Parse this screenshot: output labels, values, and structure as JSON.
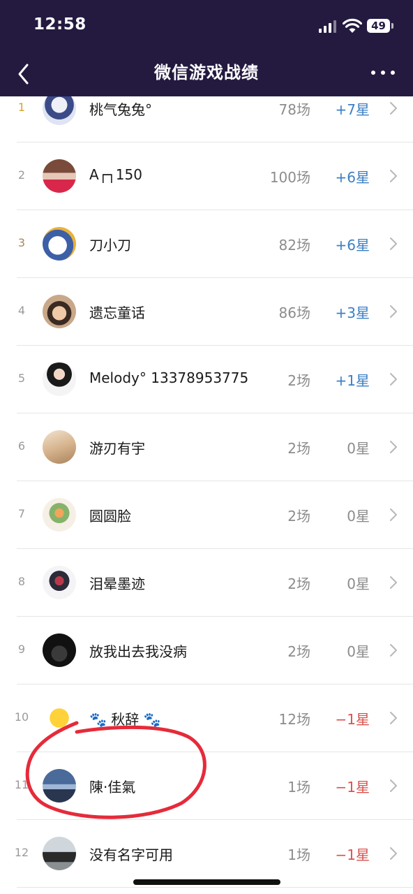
{
  "status_bar": {
    "time": "12:58",
    "battery": "49"
  },
  "nav": {
    "title": "微信游戏战绩",
    "back_icon": "chevron-left-icon",
    "more_icon": "ellipsis-icon"
  },
  "colors": {
    "header_bg": "#241a40",
    "positive": "#3b7fc4",
    "neutral": "#8c8c8c",
    "negative": "#d9534f",
    "rank_gold": "#d2a623",
    "rank_bronze": "#a8865c",
    "annotation": "#e52b3a"
  },
  "rows": [
    {
      "rank": "1",
      "name": "桃气兔兔°",
      "games": "78场",
      "stars": "+7星",
      "trend": "positive",
      "avatar": "anime-girl-avatar"
    },
    {
      "rank": "2",
      "name": "A┌┐150",
      "games": "100场",
      "stars": "+6星",
      "trend": "positive",
      "avatar": "festival-poster-avatar"
    },
    {
      "rank": "3",
      "name": "刀小刀",
      "games": "82场",
      "stars": "+6星",
      "trend": "positive",
      "avatar": "white-bird-avatar"
    },
    {
      "rank": "4",
      "name": "遗忘童话",
      "games": "86场",
      "stars": "+3星",
      "trend": "positive",
      "avatar": "child-portrait-avatar"
    },
    {
      "rank": "5",
      "name": "Melody° 13378953775",
      "games": "2场",
      "stars": "+1星",
      "trend": "positive",
      "avatar": "woman-portrait-avatar"
    },
    {
      "rank": "6",
      "name": "游刃有宇",
      "games": "2场",
      "stars": "0星",
      "trend": "neutral",
      "avatar": "beige-photo-avatar"
    },
    {
      "rank": "7",
      "name": "圆圆脸",
      "games": "2场",
      "stars": "0星",
      "trend": "neutral",
      "avatar": "flower-bouquet-avatar"
    },
    {
      "rank": "8",
      "name": "泪晕墨迹",
      "games": "2场",
      "stars": "0星",
      "trend": "neutral",
      "avatar": "ink-art-avatar"
    },
    {
      "rank": "9",
      "name": "放我出去我没病",
      "games": "2场",
      "stars": "0星",
      "trend": "neutral",
      "avatar": "dark-photo-avatar"
    },
    {
      "rank": "10",
      "name": "🐾 秋辞 🐾",
      "games": "12场",
      "stars": "−1星",
      "trend": "negative",
      "avatar": "sun-emoji-avatar"
    },
    {
      "rank": "11",
      "name": "陳·佳氣",
      "games": "1场",
      "stars": "−1星",
      "trend": "negative",
      "avatar": "city-night-avatar"
    },
    {
      "rank": "12",
      "name": "没有名字可用",
      "games": "1场",
      "stars": "−1星",
      "trend": "negative",
      "avatar": "street-person-avatar"
    }
  ]
}
